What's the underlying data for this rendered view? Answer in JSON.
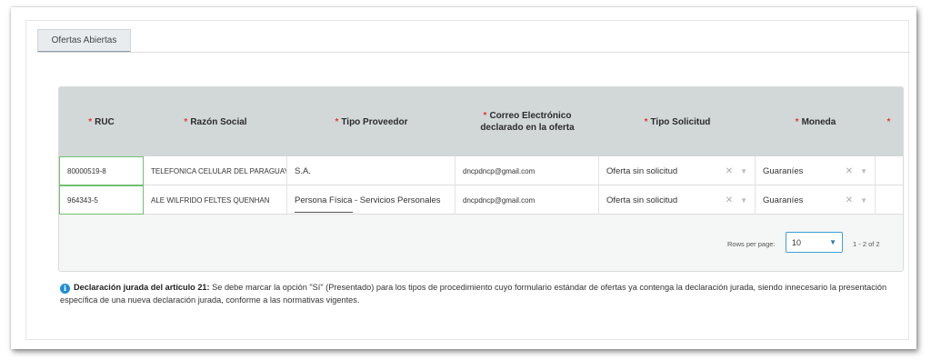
{
  "tab": {
    "label": "Ofertas Abiertas"
  },
  "table": {
    "headers": [
      "RUC",
      "Razón Social",
      "Tipo Proveedor",
      "Correo Electrónico declarado en la oferta",
      "Tipo Solicitud",
      "Moneda"
    ],
    "rows": [
      {
        "ruc": "80000519-8",
        "razon": "TELEFONICA CELULAR DEL PARAGUAY S.",
        "tipo_proveedor": "S.A.",
        "correo": "dncpdncp@gmail.com",
        "tipo_solicitud": "Oferta sin solicitud",
        "moneda": "Guaraníes"
      },
      {
        "ruc": "964343-5",
        "razon": "ALE WILFRIDO FELTES QUENHAN",
        "tipo_proveedor": "Persona Física - Servicios Personales",
        "correo": "dncpdncp@gmail.com",
        "tipo_solicitud": "Oferta sin solicitud",
        "moneda": "Guaraníes"
      }
    ]
  },
  "pagination": {
    "rows_label": "Rows per page:",
    "rows_value": "10",
    "page_info": "1 - 2 of 2"
  },
  "note": {
    "bold": "Declaración jurada del artículo 21:",
    "text": " Se debe marcar la opción \"Sí\" (Presentado) para los tipos de procedimiento cuyo formulario estándar de ofertas ya contenga la declaración jurada, siendo innecesario la presentación específica de una nueva declaración jurada, conforme a las normativas vigentes."
  },
  "colors": {
    "header_bg": "#d2d8d8",
    "required": "#e53935",
    "accent": "#3ba0d8",
    "info": "#1e8fd6"
  }
}
